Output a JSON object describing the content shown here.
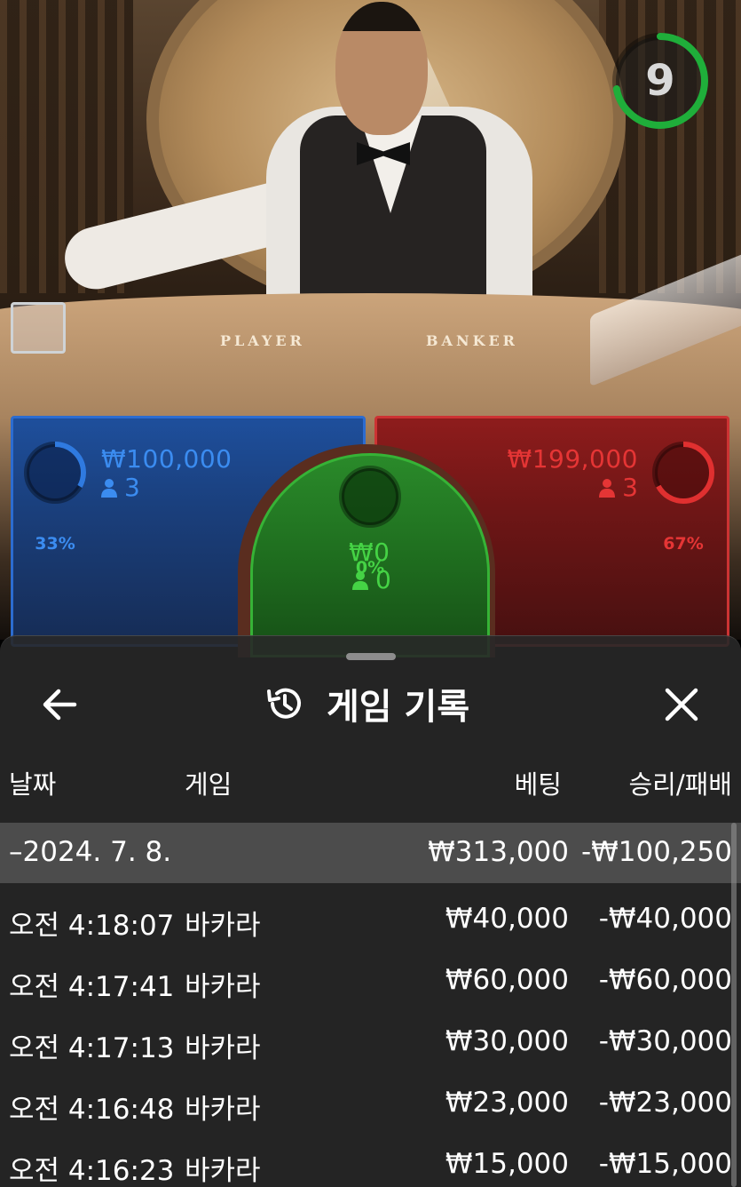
{
  "timer": {
    "value": "9",
    "color": "#1fae3a"
  },
  "table": {
    "player_label": "PLAYER",
    "banker_label": "BANKER"
  },
  "bets": {
    "player": {
      "percent": "33%",
      "percent_value": 33,
      "amount": "₩100,000",
      "count": "3",
      "color": "#2c6cd0"
    },
    "tie": {
      "percent": "0%",
      "percent_value": 0,
      "amount": "₩0",
      "count": "0",
      "color": "#36b336"
    },
    "banker": {
      "percent": "67%",
      "percent_value": 67,
      "amount": "₩199,000",
      "count": "3",
      "color": "#e03030"
    }
  },
  "sheet": {
    "title": "게임 기록",
    "back_icon": "arrow-left-icon",
    "history_icon": "history-icon",
    "close_icon": "close-icon",
    "columns": {
      "date": "날짜",
      "game": "게임",
      "bet": "베팅",
      "win_loss": "승리/패배"
    },
    "date_group": {
      "date": "–2024. 7. 8.",
      "bet": "₩313,000",
      "win_loss": "-₩100,250"
    },
    "rows": [
      {
        "time": "오전 4:18:07",
        "game": "바카라",
        "bet": "₩40,000",
        "win_loss": "-₩40,000"
      },
      {
        "time": "오전 4:17:41",
        "game": "바카라",
        "bet": "₩60,000",
        "win_loss": "-₩60,000"
      },
      {
        "time": "오전 4:17:13",
        "game": "바카라",
        "bet": "₩30,000",
        "win_loss": "-₩30,000"
      },
      {
        "time": "오전 4:16:48",
        "game": "바카라",
        "bet": "₩23,000",
        "win_loss": "-₩23,000"
      },
      {
        "time": "오전 4:16:23",
        "game": "바카라",
        "bet": "₩15,000",
        "win_loss": "-₩15,000"
      }
    ]
  }
}
